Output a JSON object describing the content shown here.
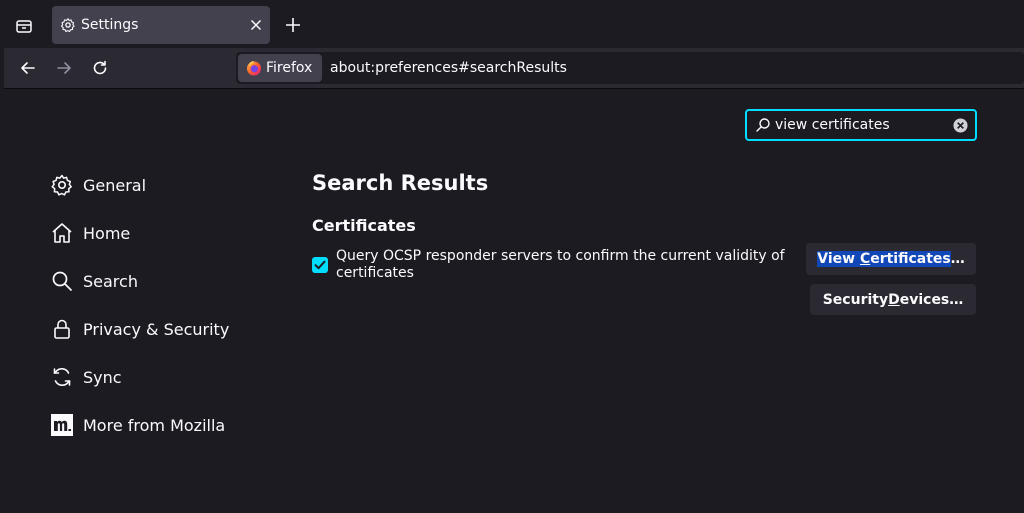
{
  "tab": {
    "title": "Settings"
  },
  "urlbar": {
    "identity_label": "Firefox",
    "url": "about:preferences#searchResults"
  },
  "search": {
    "value": "view certificates"
  },
  "sidebar": {
    "items": [
      {
        "label": "General",
        "icon": "gear-icon"
      },
      {
        "label": "Home",
        "icon": "home-icon"
      },
      {
        "label": "Search",
        "icon": "search-icon"
      },
      {
        "label": "Privacy & Security",
        "icon": "lock-icon"
      },
      {
        "label": "Sync",
        "icon": "sync-icon"
      },
      {
        "label": "More from Mozilla",
        "icon": "mozilla-icon"
      }
    ]
  },
  "main": {
    "heading": "Search Results",
    "section_title": "Certificates",
    "ocsp_label": "Query OCSP responder servers to confirm the current validity of certificates",
    "ocsp_checked": true,
    "view_cert_button": {
      "before": "View ",
      "access_key": "C",
      "after": "ertificates",
      "ellipsis": "…"
    },
    "security_devices_button": {
      "before": "Security ",
      "access_key": "D",
      "after": "evices…"
    }
  },
  "colors": {
    "accent": "#00ddff",
    "selection": "#1147b6",
    "background": "#1c1b22",
    "toolbar": "#2b2a33"
  }
}
